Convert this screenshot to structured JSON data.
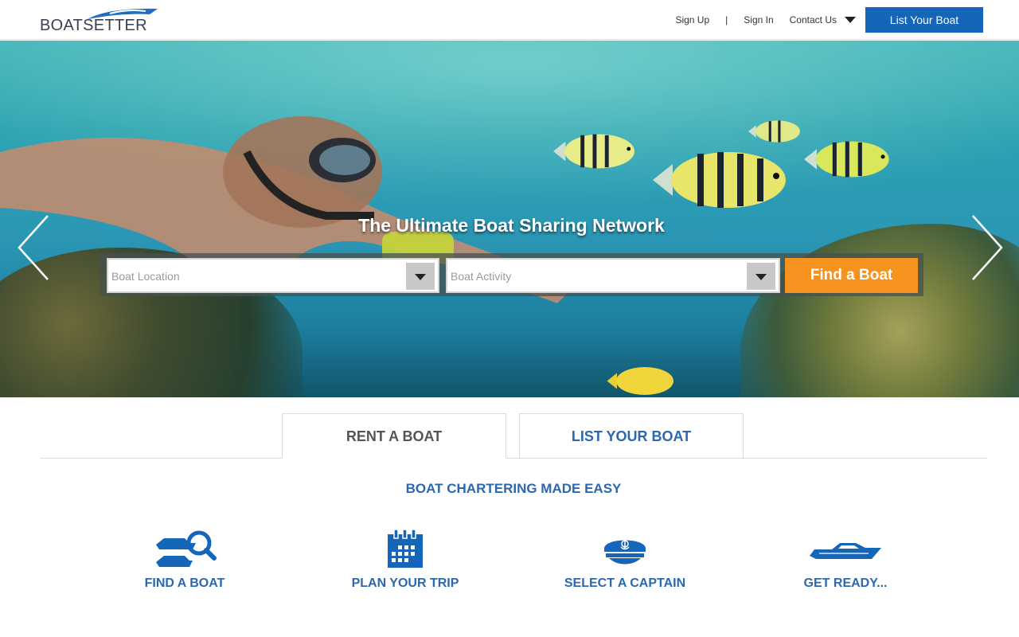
{
  "header": {
    "logo_text": "BOATSETTER",
    "nav": {
      "sign_up": "Sign Up",
      "separator": "|",
      "sign_in": "Sign In",
      "contact": "Contact Us",
      "list_boat": "List Your Boat"
    }
  },
  "hero": {
    "tagline": "The Ultimate Boat Sharing Network",
    "search": {
      "location_placeholder": "Boat Location",
      "activity_placeholder": "Boat Activity",
      "find_button": "Find a Boat"
    },
    "prev_icon": "chevron-left-icon",
    "next_icon": "chevron-right-icon"
  },
  "tabs": [
    {
      "label": "RENT A BOAT",
      "active": true
    },
    {
      "label": "LIST YOUR BOAT",
      "active": false
    }
  ],
  "section_title": "BOAT CHARTERING MADE EASY",
  "features": [
    {
      "label": "FIND A BOAT",
      "icon": "boat-search-icon"
    },
    {
      "label": "PLAN YOUR TRIP",
      "icon": "calendar-icon"
    },
    {
      "label": "SELECT A CAPTAIN",
      "icon": "captain-hat-icon"
    },
    {
      "label": "GET READY...",
      "icon": "speedboat-icon"
    }
  ],
  "colors": {
    "brand_blue": "#1565b8",
    "heading_blue": "#2b68ad",
    "cta_orange": "#f6921e"
  }
}
